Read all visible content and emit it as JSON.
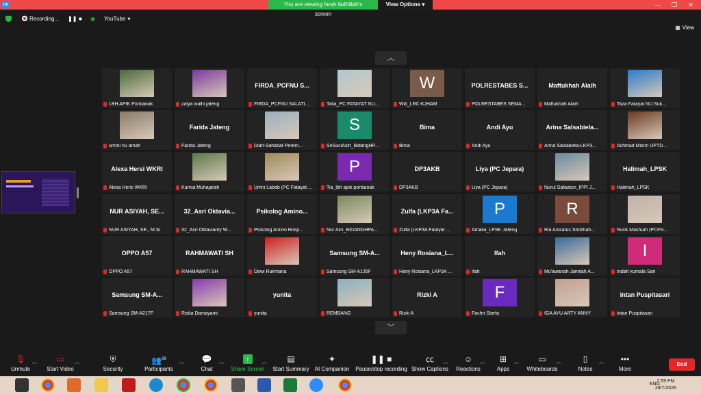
{
  "window": {
    "banner_text": "You are viewing farah fadhillah's screen",
    "view_options": "View Options"
  },
  "topbar": {
    "recording": "Recording...",
    "youtube": "YouTube",
    "view": "View"
  },
  "participants": [
    {
      "name": "",
      "caption": "LBH APIK Pontianak",
      "kind": "photo",
      "color": "#4a6a3a"
    },
    {
      "name": "",
      "caption": "zalya walhi jateng",
      "kind": "photo",
      "color": "#7a3aa0"
    },
    {
      "name": "FIRDA_PCFNU S...",
      "caption": "FIRDA_PCFNU SALATI...",
      "kind": "name"
    },
    {
      "name": "",
      "caption": "Talia_PC FATAYAT NU...",
      "kind": "photo",
      "color": "#b0c8d0"
    },
    {
      "name": "",
      "caption": "Witi_LRC-KJHAM",
      "kind": "letter",
      "letter": "W",
      "color": "#7a5a48"
    },
    {
      "name": "POLRESTABES S...",
      "caption": "POLRESTABES SEMA...",
      "kind": "name"
    },
    {
      "name": "Maftukhah Alaih",
      "caption": "Maftukhah Alaih",
      "kind": "name"
    },
    {
      "name": "",
      "caption": "Taza Fatayat NU Suk...",
      "kind": "photo",
      "color": "#2a7ad0"
    },
    {
      "name": "",
      "caption": "ummi nu amah",
      "kind": "photo",
      "color": "#8a7a6a"
    },
    {
      "name": "Farida  Jateng",
      "caption": "Farida  Jateng",
      "kind": "name"
    },
    {
      "name": "",
      "caption": "Diah-Sahabat Perem...",
      "kind": "photo",
      "color": "#9ab0c0"
    },
    {
      "name": "",
      "caption": "SriSuciAsih_BidangHP...",
      "kind": "letter",
      "letter": "S",
      "color": "#1a8a6a"
    },
    {
      "name": "Bima",
      "caption": "Bima",
      "kind": "name"
    },
    {
      "name": "Andi Ayu",
      "caption": "Andi Ayu",
      "kind": "name"
    },
    {
      "name": "Arina  Salsabiela...",
      "caption": "Arina Salsabiela-LKP3...",
      "kind": "name"
    },
    {
      "name": "",
      "caption": "Achmad Misrin UPTD...",
      "kind": "photo",
      "color": "#6a3a20"
    },
    {
      "name": "Alexa Hersi WKRI",
      "caption": "Alexa Hersi WKRI",
      "kind": "name"
    },
    {
      "name": "",
      "caption": "Kurnia Muhajarah",
      "kind": "photo",
      "color": "#5a7a4a"
    },
    {
      "name": "",
      "caption": "Umni Labeb (PC Fatayat ...",
      "kind": "photo",
      "color": "#a08a5a"
    },
    {
      "name": "",
      "caption": "Tia_lbh apik pontianak",
      "kind": "letter",
      "letter": "P",
      "color": "#7a2ab0"
    },
    {
      "name": "DP3AKB",
      "caption": "DP3AKB",
      "kind": "name"
    },
    {
      "name": "Liya (PC Jepara)",
      "caption": "Liya (PC Jepara)",
      "kind": "name"
    },
    {
      "name": "",
      "caption": "Nurul Safaatun_IPPI J...",
      "kind": "photo",
      "color": "#6a8aa0"
    },
    {
      "name": "Halimah_LPSK",
      "caption": "Halimah_LPSK",
      "kind": "name"
    },
    {
      "name": "NUR ASIYAH, SE...",
      "caption": "NUR ASIYAH, SE., M.Si",
      "kind": "name"
    },
    {
      "name": "32_Asri  Oktavia...",
      "caption": "32_Asri Oktavianty W...",
      "kind": "name"
    },
    {
      "name": "Psikolog  Amino...",
      "caption": "Psikolog Amino Hosp...",
      "kind": "name"
    },
    {
      "name": "",
      "caption": "Nur Aini_BIDANGHPA...",
      "kind": "photo",
      "color": "#7a8a5a"
    },
    {
      "name": "Zulfa (LKP3A Fa...",
      "caption": "Zulfa (LKP3A Fatayat ...",
      "kind": "name"
    },
    {
      "name": "",
      "caption": "Amalia_LPSK Jateng",
      "kind": "letter",
      "letter": "P",
      "color": "#1a7ad0"
    },
    {
      "name": "",
      "caption": "Ria Anisatus Sholihah...",
      "kind": "letter",
      "letter": "R",
      "color": "#7a4a3a"
    },
    {
      "name": "",
      "caption": "Nurik Masfuah (PCFN...",
      "kind": "photo",
      "color": "#c0b0a8"
    },
    {
      "name": "OPPO A57",
      "caption": "OPPO A57",
      "kind": "name"
    },
    {
      "name": "RAHMAWATI  SH",
      "caption": "RAHMAWATI  SH",
      "kind": "name"
    },
    {
      "name": "",
      "caption": "Dewi Rukmana",
      "kind": "photo",
      "color": "#d02020"
    },
    {
      "name": "Samsung  SM-A...",
      "caption": "Samsung SM-A135F",
      "kind": "name"
    },
    {
      "name": "Heny  Rosiana_L...",
      "caption": "Heny Rosiana_LKP3A ...",
      "kind": "name"
    },
    {
      "name": "Ifah",
      "caption": "Ifah",
      "kind": "name"
    },
    {
      "name": "",
      "caption": "Mu'awanah Jamilah A...",
      "kind": "photo",
      "color": "#3a6a9a"
    },
    {
      "name": "",
      "caption": "Indah kumala Sari",
      "kind": "letter",
      "letter": "I",
      "color": "#d02a7a"
    },
    {
      "name": "Samsung  SM-A...",
      "caption": "Samsung SM-A217F",
      "kind": "name"
    },
    {
      "name": "",
      "caption": "Riska Damayanti",
      "kind": "photo",
      "color": "#8a3ab0"
    },
    {
      "name": "yunita",
      "caption": "yunita",
      "kind": "name"
    },
    {
      "name": "",
      "caption": "REMBANG",
      "kind": "photo",
      "color": "#8ab0c0"
    },
    {
      "name": "Rizki A",
      "caption": "Rizki A",
      "kind": "name"
    },
    {
      "name": "",
      "caption": "Fachri Starfa",
      "kind": "letter",
      "letter": "F",
      "color": "#6a2ac0"
    },
    {
      "name": "",
      "caption": "IGA AYU ARTY ANNY",
      "kind": "photo",
      "color": "#c0a090"
    },
    {
      "name": "Intan Puspitasari",
      "caption": "Intan Puspitasari",
      "kind": "name"
    }
  ],
  "toolbar": {
    "unmute": "Unmute",
    "start_video": "Start Video",
    "security": "Security",
    "participants": "Participants",
    "participants_count": "99",
    "chat": "Chat",
    "share_screen": "Share Screen",
    "start_summary": "Start Summary",
    "ai_companion": "AI Companion",
    "pause_recording": "Pause/stop recording",
    "show_captions": "Show Captions",
    "reactions": "Reactions",
    "apps": "Apps",
    "whiteboards": "Whiteboards",
    "notes": "Notes",
    "more": "More",
    "end": "End"
  },
  "taskbar": {
    "lang": "ENG",
    "time": "2:59 PM",
    "date": "28/7/2026"
  },
  "colors": {
    "tile_bg": "#232323",
    "accent_green": "#29b849",
    "end_red": "#e02828",
    "title_red": "#f04848"
  }
}
